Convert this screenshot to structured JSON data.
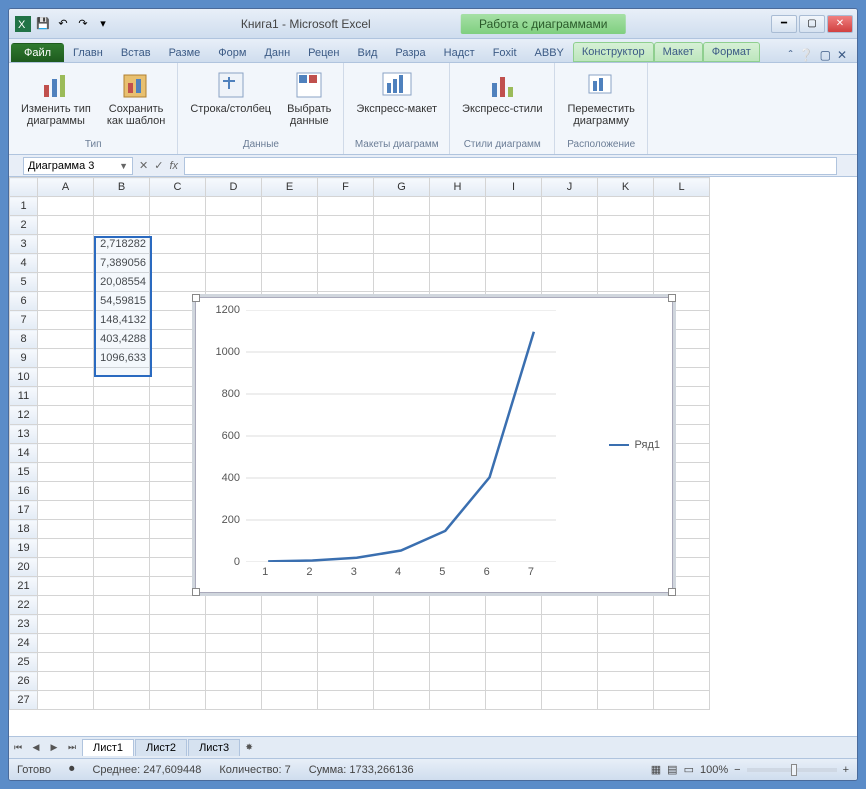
{
  "title": {
    "doc": "Книга1",
    "app": "Microsoft Excel",
    "chart_tools": "Работа с диаграммами"
  },
  "tabs": {
    "file": "Файл",
    "items": [
      "Главн",
      "Встав",
      "Разме",
      "Форм",
      "Данн",
      "Рецен",
      "Вид",
      "Разра",
      "Надст",
      "Foxit",
      "ABBY"
    ],
    "context": [
      "Конструктор",
      "Макет",
      "Формат"
    ]
  },
  "ribbon": {
    "g1": {
      "btn1": "Изменить тип\nдиаграммы",
      "btn2": "Сохранить\nкак шаблон",
      "name": "Тип"
    },
    "g2": {
      "btn1": "Строка/столбец",
      "btn2": "Выбрать\nданные",
      "name": "Данные"
    },
    "g3": {
      "btn1": "Экспресс-макет",
      "name": "Макеты диаграмм"
    },
    "g4": {
      "btn1": "Экспресс-стили",
      "name": "Стили диаграмм"
    },
    "g5": {
      "btn1": "Переместить\nдиаграмму",
      "name": "Расположение"
    }
  },
  "namebox": "Диаграмма 3",
  "fx_label": "fx",
  "columns": [
    "A",
    "B",
    "C",
    "D",
    "E",
    "F",
    "G",
    "H",
    "I",
    "J",
    "K",
    "L"
  ],
  "rows": 27,
  "cells": {
    "B3": "2,718282",
    "B4": "7,389056",
    "B5": "20,08554",
    "B6": "54,59815",
    "B7": "148,4132",
    "B8": "403,4288",
    "B9": "1096,633"
  },
  "chart_data": {
    "type": "line",
    "categories": [
      1,
      2,
      3,
      4,
      5,
      6,
      7
    ],
    "series": [
      {
        "name": "Ряд1",
        "values": [
          2.718282,
          7.389056,
          20.08554,
          54.59815,
          148.4132,
          403.4288,
          1096.633
        ]
      }
    ],
    "ylim": [
      0,
      1200
    ],
    "yticks": [
      0,
      200,
      400,
      600,
      800,
      1000,
      1200
    ],
    "xlabel": "",
    "ylabel": "",
    "title": ""
  },
  "legend_label": "Ряд1",
  "sheets": [
    "Лист1",
    "Лист2",
    "Лист3"
  ],
  "status": {
    "ready": "Готово",
    "avg_label": "Среднее:",
    "avg": "247,609448",
    "count_label": "Количество:",
    "count": "7",
    "sum_label": "Сумма:",
    "sum": "1733,266136",
    "zoom": "100%"
  }
}
